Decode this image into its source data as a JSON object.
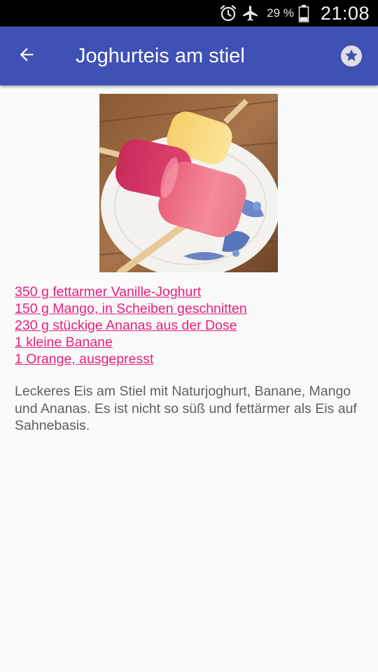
{
  "status_bar": {
    "battery_percent": "29 %",
    "time": "21:08",
    "icons": [
      "alarm-icon",
      "airplane-mode-icon",
      "battery-icon"
    ]
  },
  "app_bar": {
    "title": "Joghurteis am stiel",
    "back_icon": "arrow-back-icon",
    "favorite_icon": "star-icon"
  },
  "recipe": {
    "ingredients": [
      "350 g fettarmer Vanille-Joghurt",
      "150 g Mango, in Scheiben geschnitten",
      "230 g stückige Ananas aus der Dose",
      "1 kleine Banane",
      "1 Orange, ausgepresst"
    ],
    "description": "Leckeres Eis am Stiel mit Naturjoghurt, Banane, Mango und Ananas. Es ist nicht so süß und fettärmer als Eis auf Sahnebasis."
  },
  "colors": {
    "app_bar": "#3f51b5",
    "status_bar": "#000000",
    "ingredient_link": "#e91e7b",
    "body_text": "#5f5f5f",
    "background": "#fafafa"
  }
}
